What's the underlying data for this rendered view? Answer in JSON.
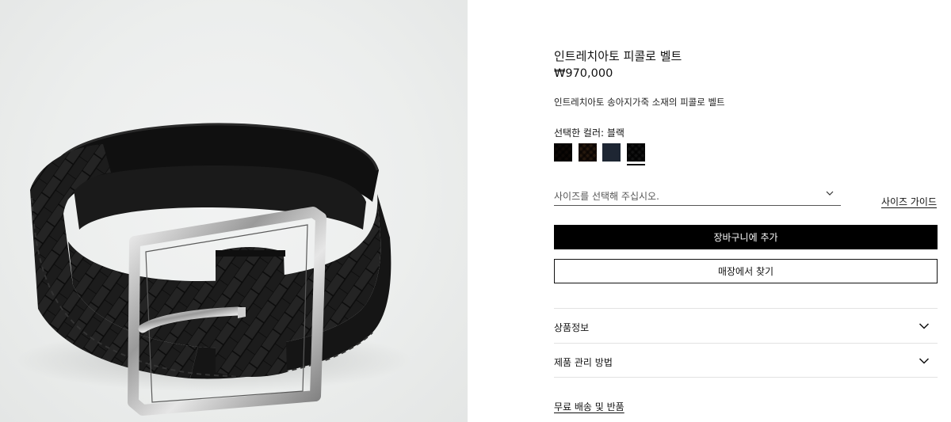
{
  "product": {
    "title": "인트레치아토 피콜로 벨트",
    "price": "₩970,000",
    "description": "인트레치아토 송아지가죽 소재의 피콜로 벨트",
    "selected_color_label": "선택한 컬러: 블랙",
    "image_icon": "woven-leather-belt-product-image"
  },
  "swatches": [
    {
      "name": "dark-brown",
      "color": "#2b2119"
    },
    {
      "name": "brown",
      "color": "#4c3b2a"
    },
    {
      "name": "navy",
      "color": "#1e2633"
    },
    {
      "name": "black",
      "color": "#222222",
      "selected": true
    }
  ],
  "size": {
    "placeholder": "사이즈를 선택해 주십시오.",
    "guide_label": "사이즈 가이드",
    "icon": "chevron-down-icon"
  },
  "actions": {
    "add_to_cart": "장바구니에 추가",
    "find_in_store": "매장에서 찾기"
  },
  "accordion": [
    {
      "label": "상품정보",
      "icon": "chevron-down-icon"
    },
    {
      "label": "제품 관리 방법",
      "icon": "chevron-down-icon"
    }
  ],
  "links": {
    "shipping_returns": "무료 배송 및 반품"
  },
  "colors": {
    "primary_button": "#000000",
    "background": "#ffffff",
    "image_background": "#eceeed"
  }
}
